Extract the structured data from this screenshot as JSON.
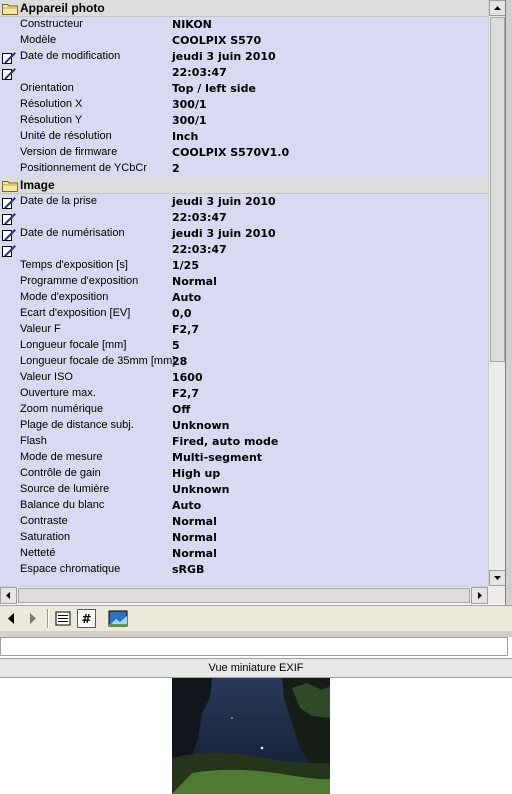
{
  "groups": [
    {
      "title": "Appareil photo",
      "rows": [
        {
          "label": "Constructeur",
          "value": "NIKON"
        },
        {
          "label": "Modèle",
          "value": "COOLPIX S570"
        },
        {
          "label": "Date de modification",
          "value": "jeudi 3 juin 2010",
          "editable": true
        },
        {
          "label": "",
          "value": "22:03:47",
          "editable": true
        },
        {
          "label": "Orientation",
          "value": "Top / left side"
        },
        {
          "label": "Résolution X",
          "value": "300/1"
        },
        {
          "label": "Résolution Y",
          "value": "300/1"
        },
        {
          "label": "Unité de résolution",
          "value": "Inch"
        },
        {
          "label": "Version de firmware",
          "value": "COOLPIX S570V1.0"
        },
        {
          "label": "Positionnement de YCbCr",
          "value": "2"
        }
      ]
    },
    {
      "title": "Image",
      "rows": [
        {
          "label": "Date de la prise",
          "value": "jeudi 3 juin 2010",
          "editable": true
        },
        {
          "label": "",
          "value": "22:03:47",
          "editable": true
        },
        {
          "label": "Date de numérisation",
          "value": "jeudi 3 juin 2010",
          "editable": true
        },
        {
          "label": "",
          "value": "22:03:47",
          "editable": true
        },
        {
          "label": "Temps d'exposition [s]",
          "value": "1/25"
        },
        {
          "label": "Programme d'exposition",
          "value": "Normal"
        },
        {
          "label": "Mode d'exposition",
          "value": "Auto"
        },
        {
          "label": "Ecart d'exposition [EV]",
          "value": "0,0"
        },
        {
          "label": "Valeur F",
          "value": "F2,7"
        },
        {
          "label": "Longueur focale [mm]",
          "value": "5"
        },
        {
          "label": "Longueur focale de 35mm [mm]",
          "value": "28"
        },
        {
          "label": "Valeur ISO",
          "value": "1600"
        },
        {
          "label": "Ouverture max.",
          "value": "F2,7"
        },
        {
          "label": "Zoom numérique",
          "value": "Off"
        },
        {
          "label": "Plage de distance subj.",
          "value": "Unknown"
        },
        {
          "label": "Flash",
          "value": "Fired, auto mode"
        },
        {
          "label": "Mode de mesure",
          "value": "Multi-segment"
        },
        {
          "label": "Contrôle de gain",
          "value": "High up"
        },
        {
          "label": "Source de lumière",
          "value": "Unknown"
        },
        {
          "label": "Balance du blanc",
          "value": "Auto"
        },
        {
          "label": "Contraste",
          "value": "Normal"
        },
        {
          "label": "Saturation",
          "value": "Normal"
        },
        {
          "label": "Netteté",
          "value": "Normal"
        },
        {
          "label": "Espace chromatique",
          "value": "sRGB"
        }
      ]
    }
  ],
  "toolbar": {
    "icons": [
      "back-arrow-icon",
      "forward-arrow-icon",
      "list-view-icon",
      "hash-view-icon",
      "thumbnail-view-icon"
    ]
  },
  "text_field": {
    "value": ""
  },
  "thumbnail": {
    "title": "Vue miniature EXIF"
  },
  "colors": {
    "row_bg": "#d7daf2",
    "group_header_bg": "#dcdcdc",
    "toolbar_bg": "#ece9d8"
  }
}
